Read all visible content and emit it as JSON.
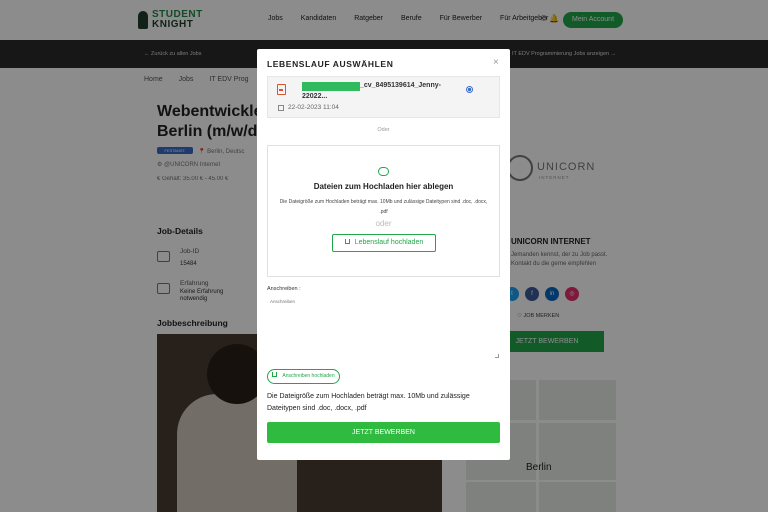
{
  "nav": {
    "logo_line1": "STUDENT",
    "logo_line2": "KNIGHT",
    "links": [
      "Jobs",
      "Kandidaten",
      "Ratgeber",
      "Berufe",
      "Für Bewerber",
      "Für Arbeitgeber"
    ],
    "icons": "⚇ 🔔",
    "account_button": "Mein Account"
  },
  "subbar": {
    "back": "← Zurück zu allen Jobs",
    "next": "IT EDV Programmierung Jobs anzeigen →"
  },
  "breadcrumb": [
    "Home",
    "Jobs",
    "IT EDV Prog"
  ],
  "job": {
    "title_line1": "Webentwickle",
    "title_line2": "Berlin (m/w/d",
    "tag": "FESTANST.",
    "location": "📍 Berlin, Deutsc",
    "company": "⚙ @UNICORN Internet",
    "salary": "€ Gehalt: 35.00 € - 45.00 €"
  },
  "details": {
    "heading": "Job-Details",
    "id_label": "Job-ID",
    "id_value": "15484",
    "exp_label": "Erfahrung",
    "exp_value": "Keine Erfahrung notwendig"
  },
  "description_heading": "Jobbeschreibung",
  "company_card": {
    "logo_text": "UNICORN",
    "logo_sub": "INTERNET",
    "name": "UNICORN INTERNET",
    "desc": "Jemanden kennst, der zu Job passt. Kontakt du die gerne empfehlen",
    "social": [
      "t",
      "f",
      "in",
      "◎"
    ],
    "merken": "♡ JOB MERKEN",
    "apply": "JETZT BEWERBEN"
  },
  "map": {
    "label": "Berlin"
  },
  "modal": {
    "title": "LEBENSLAUF AUSWÄHLEN",
    "close": "×",
    "cv_name_part1": "_cv_8495139614_Jenny-",
    "cv_name_part2": "22022...",
    "cv_date": "22-02-2023 11:04",
    "oder_small": "Oder",
    "dropzone_title": "Dateien zum Hochladen hier ablegen",
    "dropzone_info": "Die Dateigröße zum Hochladen beträgt max. 10Mb und zulässige Dateitypen sind .doc, .docx, .pdf",
    "oder_big": "oder",
    "upload_button": "Lebenslauf hochladen",
    "anschreiben_label": "Anschreiben :",
    "anschreiben_placeholder": "Anschreiben",
    "anschreiben_upload": "Anschreiben hochladen",
    "size_note": "Die Dateigröße zum Hochladen beträgt max. 10Mb und zulässige Dateitypen sind .doc, .docx, .pdf",
    "apply_button": "JETZT BEWERBEN"
  },
  "colors": {
    "brand_green": "#22a64a",
    "apply_green": "#2fbb3f",
    "pdf_red": "#d9532f",
    "overlay": "rgba(0,0,0,0.45)"
  }
}
